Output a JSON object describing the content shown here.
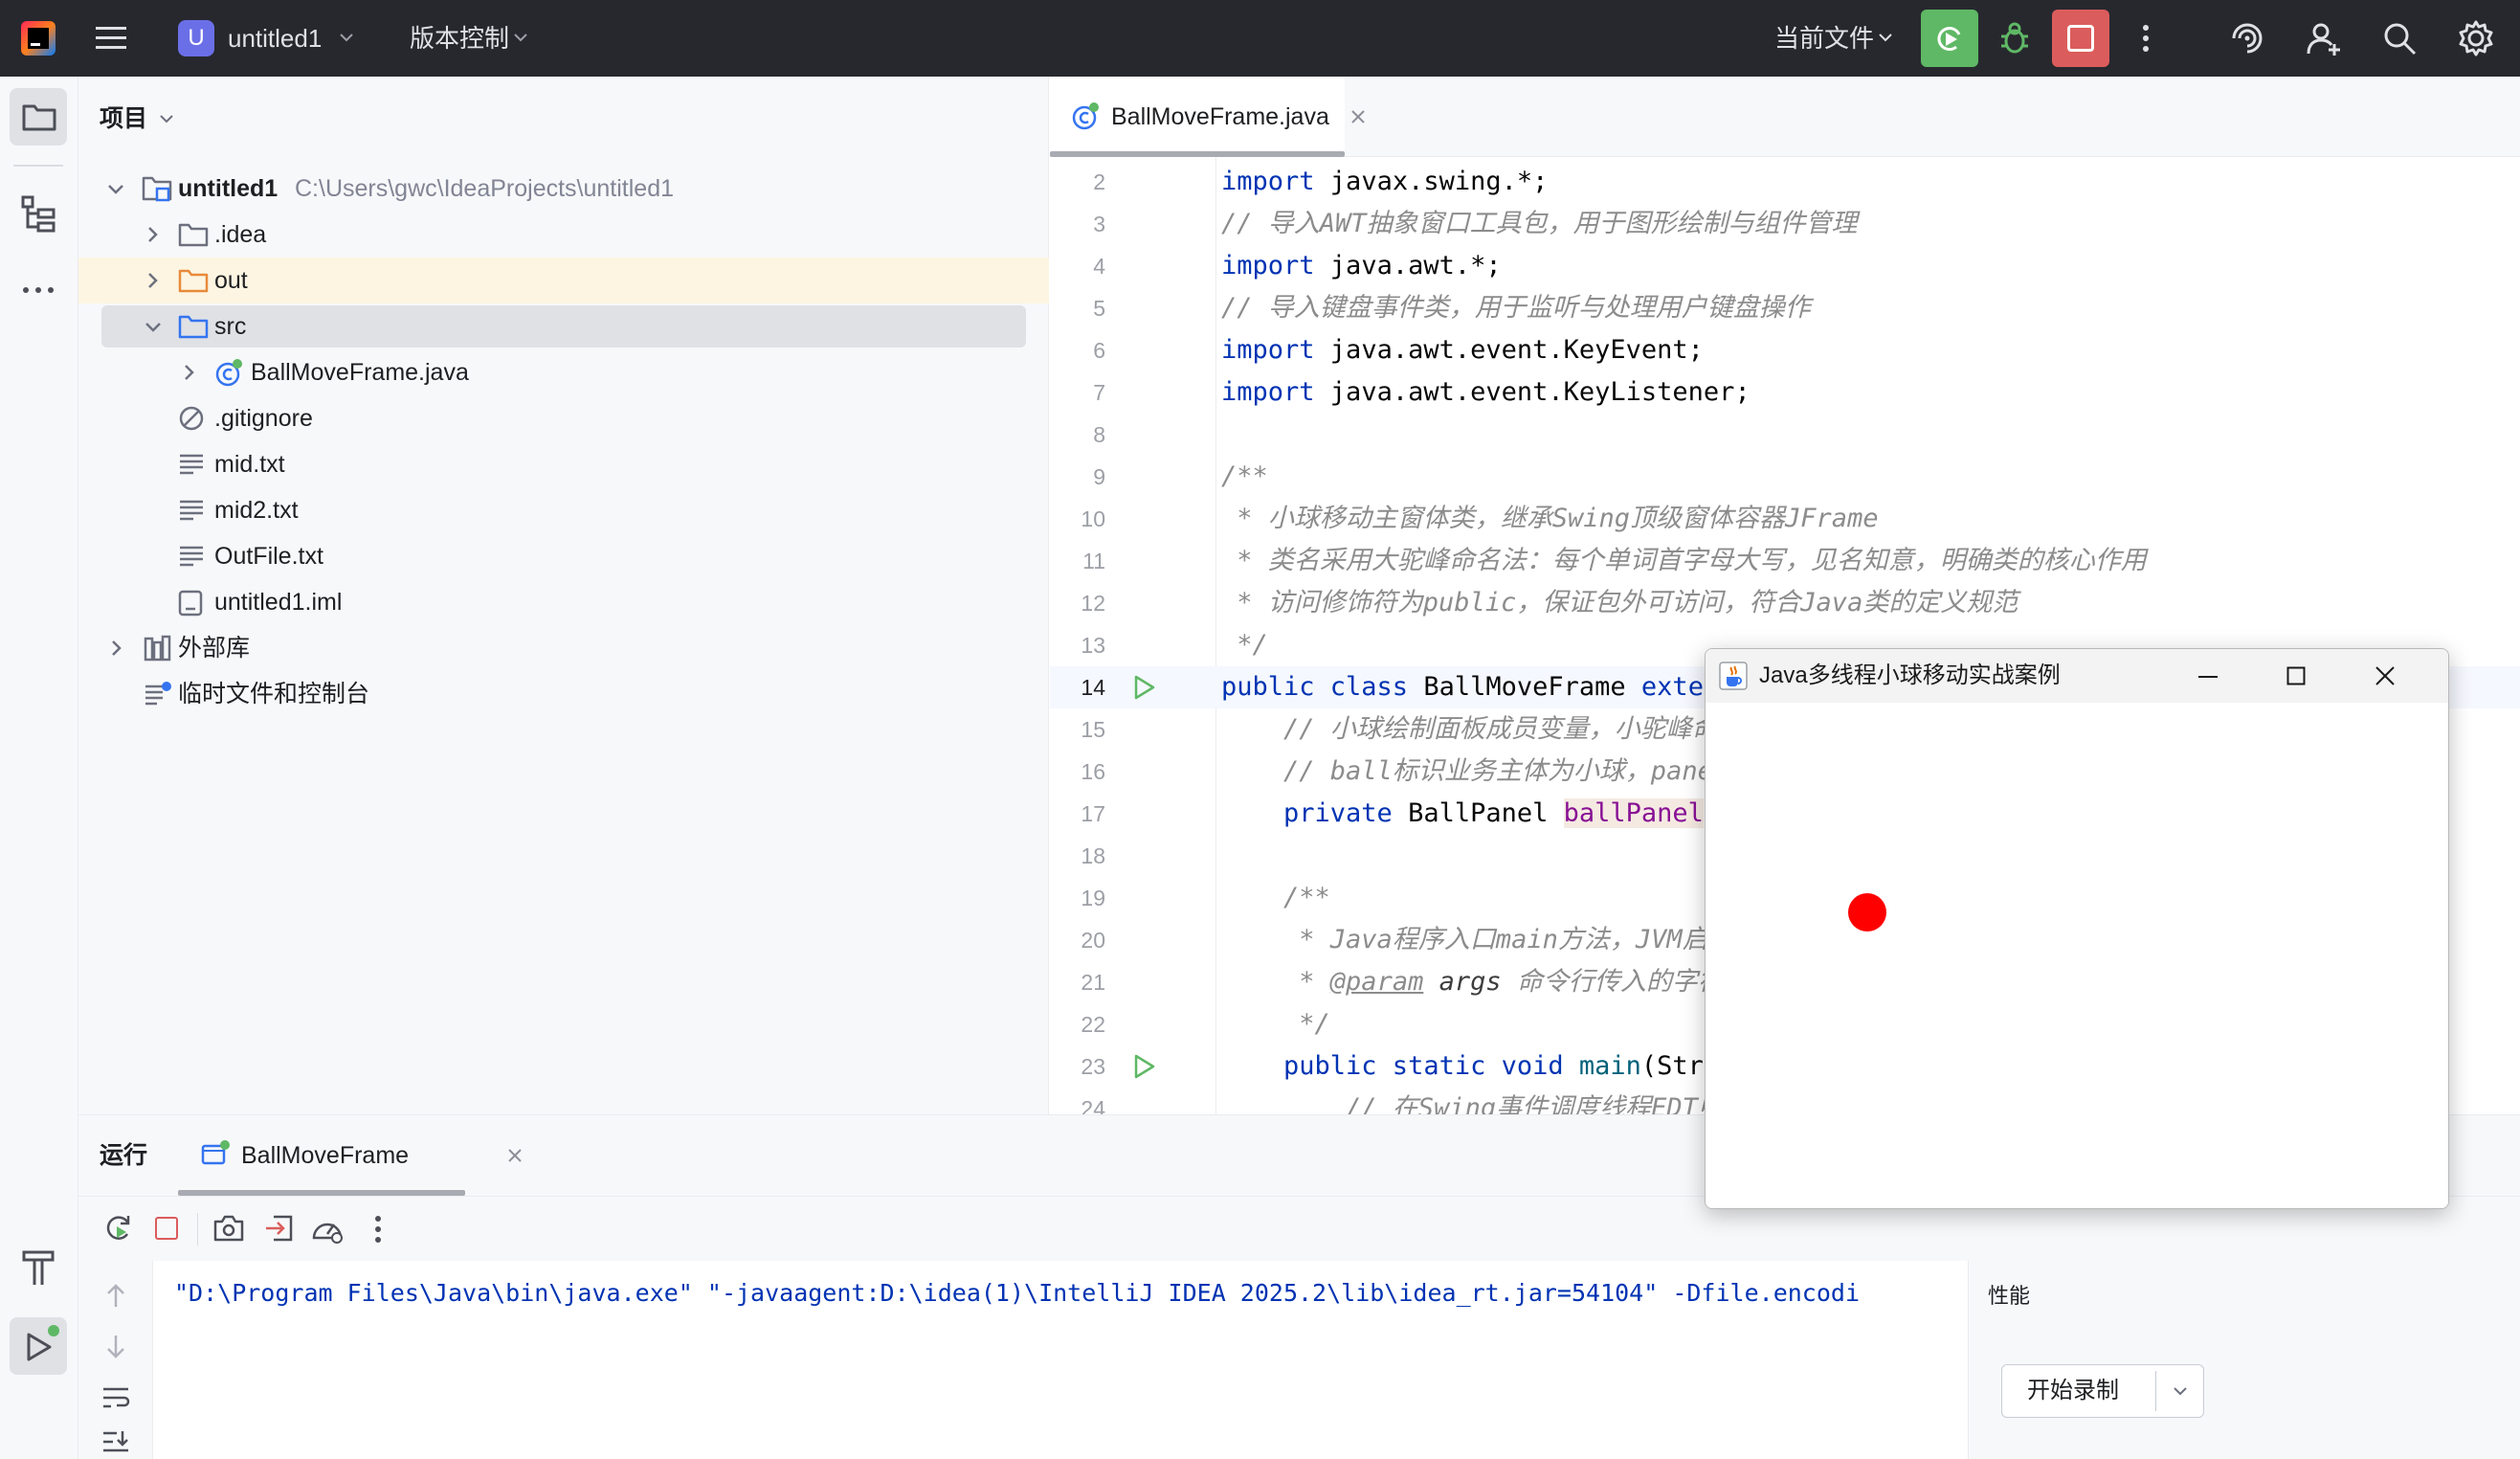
{
  "titlebar": {
    "project_badge": "U",
    "project_name": "untitled1",
    "vcs_label": "版本控制",
    "run_config": "当前文件"
  },
  "project_panel": {
    "title": "项目",
    "root_name": "untitled1",
    "root_path": "C:\\Users\\gwc\\IdeaProjects\\untitled1",
    "items": [
      {
        "label": ".idea"
      },
      {
        "label": "out"
      },
      {
        "label": "src"
      },
      {
        "label": "BallMoveFrame.java"
      },
      {
        "label": ".gitignore"
      },
      {
        "label": "mid.txt"
      },
      {
        "label": "mid2.txt"
      },
      {
        "label": "OutFile.txt"
      },
      {
        "label": "untitled1.iml"
      },
      {
        "label": "外部库"
      },
      {
        "label": "临时文件和控制台"
      }
    ]
  },
  "editor": {
    "tab_label": "BallMoveFrame.java",
    "line_numbers": [
      "2",
      "3",
      "4",
      "5",
      "6",
      "7",
      "8",
      "9",
      "10",
      "11",
      "12",
      "13",
      "14",
      "15",
      "16",
      "17",
      "18",
      "19",
      "20",
      "21",
      "22",
      "23",
      "24"
    ]
  },
  "code": {
    "l2": [
      "import",
      " javax.swing.*;"
    ],
    "l3": "// 导入AWT抽象窗口工具包，用于图形绘制与组件管理",
    "l4": [
      "import",
      " java.awt.*;"
    ],
    "l5": "// 导入键盘事件类，用于监听与处理用户键盘操作",
    "l6": [
      "import",
      " java.awt.event.KeyEvent;"
    ],
    "l7": [
      "import",
      " java.awt.event.KeyListener;"
    ],
    "l9": "/**",
    "l10": " * 小球移动主窗体类，继承Swing顶级窗体容器JFrame",
    "l11": " * 类名采用大驼峰命名法：每个单词首字母大写，见名知意，明确类的核心作用",
    "l12": " * 访问修饰符为public，保证包外可访问，符合Java类的定义规范",
    "l13": " */",
    "l14": [
      "public class",
      " BallMoveFrame ",
      "exter"
    ],
    "l15": "    // 小球绘制面板成员变量，小驼峰命",
    "l16": "    // ball标识业务主体为小球，panel",
    "l17": [
      "    private",
      " BallPanel ",
      "ballPanel",
      ";"
    ],
    "l19": "    /**",
    "l20": "     * Java程序入口main方法，JVM启动",
    "l21": [
      "     * ",
      "@param",
      " args",
      " 命令行传入的字符"
    ],
    "l22": "     */",
    "l23": [
      "    public static void",
      " main",
      "(Stri"
    ],
    "l24": "        // 在Swing事件调度线程EDT中"
  },
  "bottom": {
    "title": "运行",
    "run_tab": "BallMoveFrame",
    "console_line": "\"D:\\Program Files\\Java\\bin\\java.exe\" \"-javaagent:D:\\idea(1)\\IntelliJ IDEA 2025.2\\lib\\idea_rt.jar=54104\" -Dfile.encodi",
    "perf_title": "性能",
    "record_button": "开始录制"
  },
  "app_window": {
    "title": "Java多线程小球移动实战案例",
    "ball_color": "#ff0000"
  },
  "colors": {
    "accent": "#3574f0",
    "run_green": "#5fb865",
    "stop_red": "#db5c5c",
    "keyword": "#0033b3",
    "comment": "#8c8c8c"
  }
}
